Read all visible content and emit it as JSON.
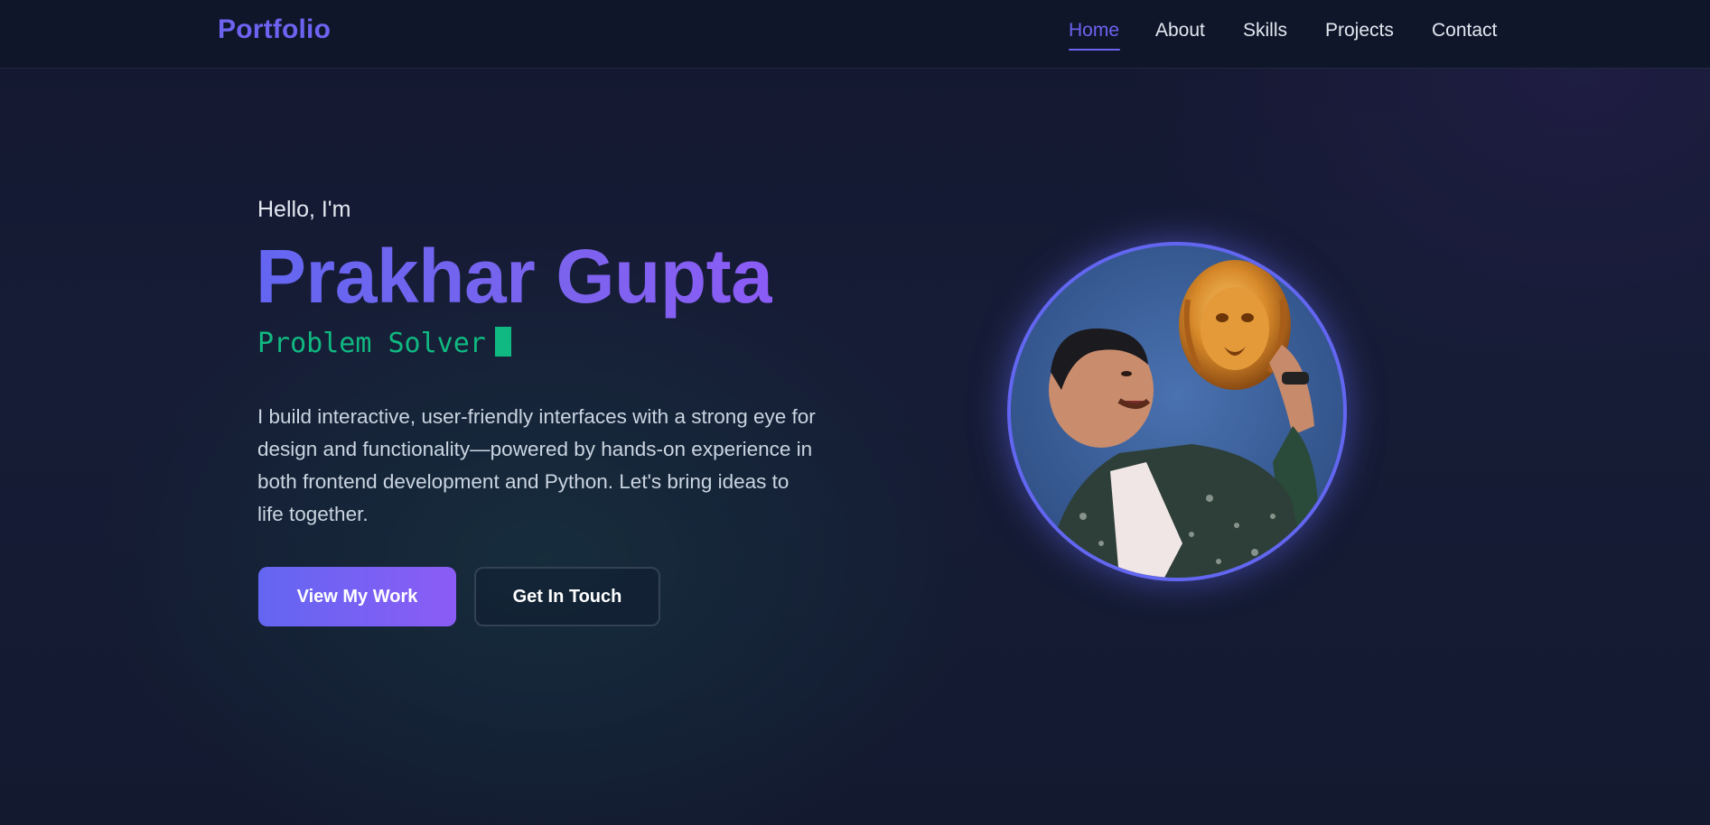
{
  "header": {
    "logo": "Portfolio",
    "nav": [
      {
        "label": "Home",
        "active": true
      },
      {
        "label": "About",
        "active": false
      },
      {
        "label": "Skills",
        "active": false
      },
      {
        "label": "Projects",
        "active": false
      },
      {
        "label": "Contact",
        "active": false
      }
    ]
  },
  "hero": {
    "greeting": "Hello, I'm",
    "name": "Prakhar Gupta",
    "role": "Problem Solver",
    "bio": "I build interactive, user-friendly interfaces with a strong eye for design and functionality—powered by hands-on experience in both frontend development and Python. Let's bring ideas to life together.",
    "primary_button": "View My Work",
    "secondary_button": "Get In Touch"
  },
  "colors": {
    "accent": "#6c63f0",
    "terminal_green": "#10b981",
    "background": "#141830",
    "navbar": "#0f1629"
  },
  "icons": {
    "avatar": "profile-photo"
  }
}
